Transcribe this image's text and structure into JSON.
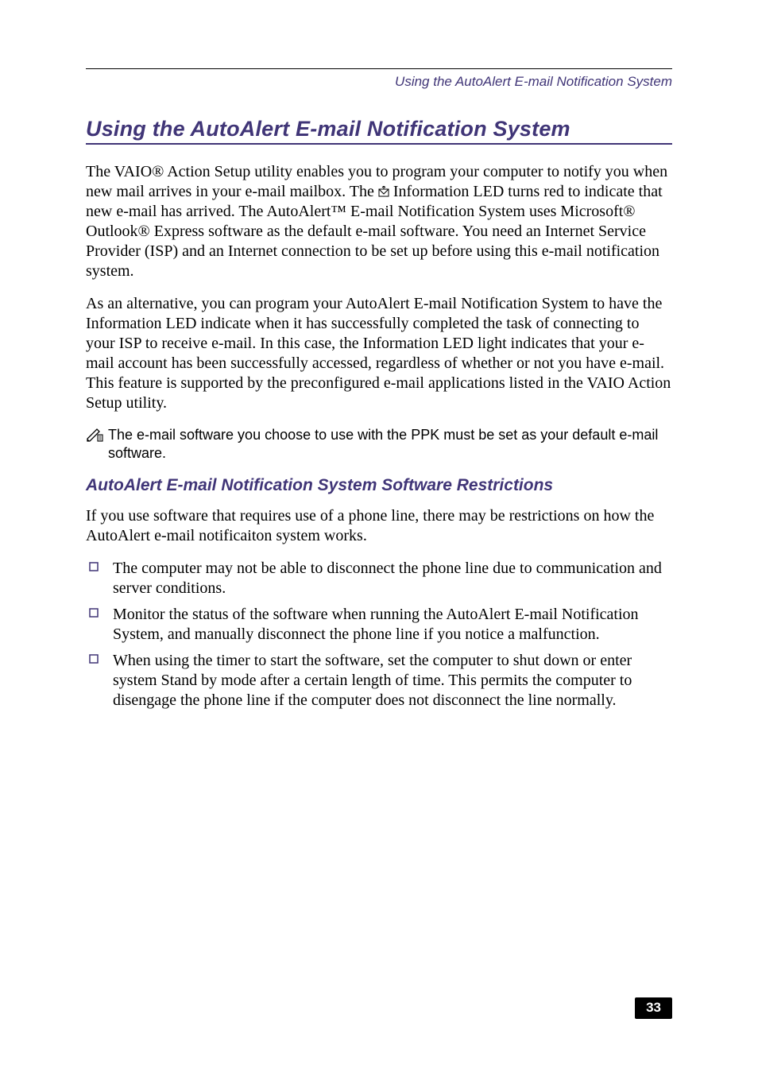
{
  "running_head": "Using the AutoAlert E-mail Notification System",
  "title": "Using the AutoAlert E-mail Notification System",
  "para1_a": "The VAIO® Action Setup utility enables you to program your computer to notify you when new mail arrives in your e-mail mailbox. The ",
  "para1_b": " Information LED turns red to indicate that new e-mail has arrived. The AutoAlert™ E-mail Notification System uses Microsoft® Outlook® Express software as the default e-mail software. You need an Internet Service Provider (ISP) and an Internet connection to be set up before using this e-mail notification system.",
  "para2": "As an alternative, you can program your AutoAlert E-mail Notification System to have the Information LED indicate when it has successfully completed the task of connecting to your ISP to receive e-mail. In this case, the Information LED light indicates that your e-mail account has been successfully accessed, regardless of whether or not you have e-mail. This feature is supported by the preconfigured e-mail applications listed in the VAIO Action Setup utility.",
  "note": "The e-mail software you choose to use with the PPK must be set as your default e-mail software.",
  "subheading": "AutoAlert E-mail Notification System Software Restrictions",
  "para3": "If you use software that requires use of a phone line, there may be restrictions on how the AutoAlert e-mail notificaiton system works.",
  "bullets": [
    "The computer may not be able to disconnect the phone line due to communication and server conditions.",
    "Monitor the status of the software when running the AutoAlert E-mail Notification System, and manually disconnect the phone line if you notice a malfunction.",
    "When using the timer to start the software, set the computer to shut down or enter system Stand by mode after a certain length of time. This permits the computer to disengage the phone line if the computer does not disconnect the line normally."
  ],
  "page_number": "33"
}
